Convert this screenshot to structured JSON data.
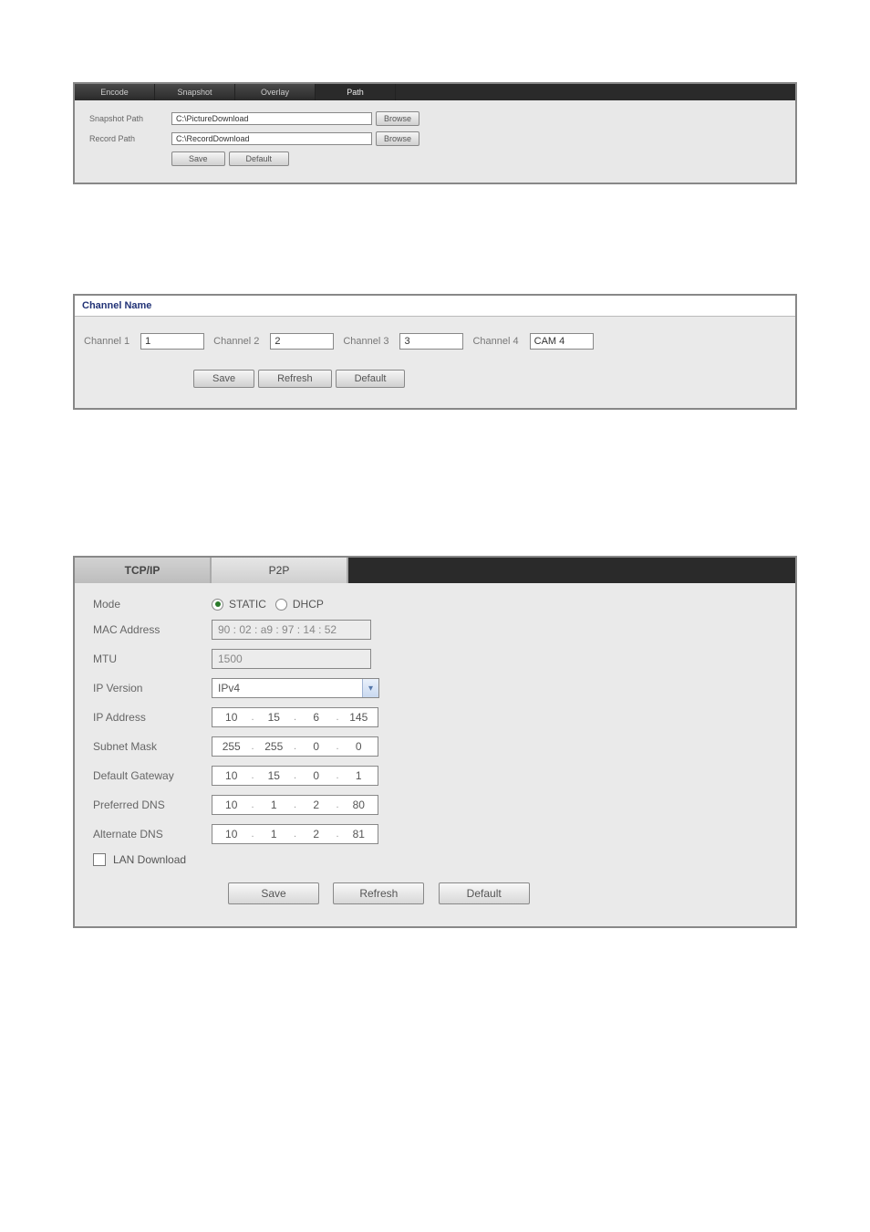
{
  "section1": {
    "tabs": [
      "Encode",
      "Snapshot",
      "Overlay",
      "Path"
    ],
    "activeTab": 3,
    "snapshotPathLabel": "Snapshot Path",
    "recordPathLabel": "Record Path",
    "snapshotPath": "C:\\PictureDownload",
    "recordPath": "C:\\RecordDownload",
    "browseLabel": "Browse",
    "saveLabel": "Save",
    "defaultLabel": "Default"
  },
  "section2": {
    "header": "Channel Name",
    "channels": [
      {
        "label": "Channel 1",
        "value": "1"
      },
      {
        "label": "Channel 2",
        "value": "2"
      },
      {
        "label": "Channel 3",
        "value": "3"
      },
      {
        "label": "Channel 4",
        "value": "CAM 4"
      }
    ],
    "saveLabel": "Save",
    "refreshLabel": "Refresh",
    "defaultLabel": "Default"
  },
  "section3": {
    "tabs": [
      "TCP/IP",
      "P2P"
    ],
    "activeTab": 0,
    "modeLabel": "Mode",
    "staticLabel": "STATIC",
    "dhcpLabel": "DHCP",
    "modeValue": "STATIC",
    "macLabel": "MAC Address",
    "macValue": "90 : 02 : a9 : 97 : 14 : 52",
    "mtuLabel": "MTU",
    "mtuValue": "1500",
    "ipVersionLabel": "IP Version",
    "ipVersionValue": "IPv4",
    "ipAddrLabel": "IP Address",
    "ipAddr": [
      "10",
      "15",
      "6",
      "145"
    ],
    "subnetLabel": "Subnet Mask",
    "subnet": [
      "255",
      "255",
      "0",
      "0"
    ],
    "gatewayLabel": "Default Gateway",
    "gateway": [
      "10",
      "15",
      "0",
      "1"
    ],
    "prefDnsLabel": "Preferred DNS",
    "prefDns": [
      "10",
      "1",
      "2",
      "80"
    ],
    "altDnsLabel": "Alternate DNS",
    "altDns": [
      "10",
      "1",
      "2",
      "81"
    ],
    "lanLabel": "LAN Download",
    "saveLabel": "Save",
    "refreshLabel": "Refresh",
    "defaultLabel": "Default"
  }
}
